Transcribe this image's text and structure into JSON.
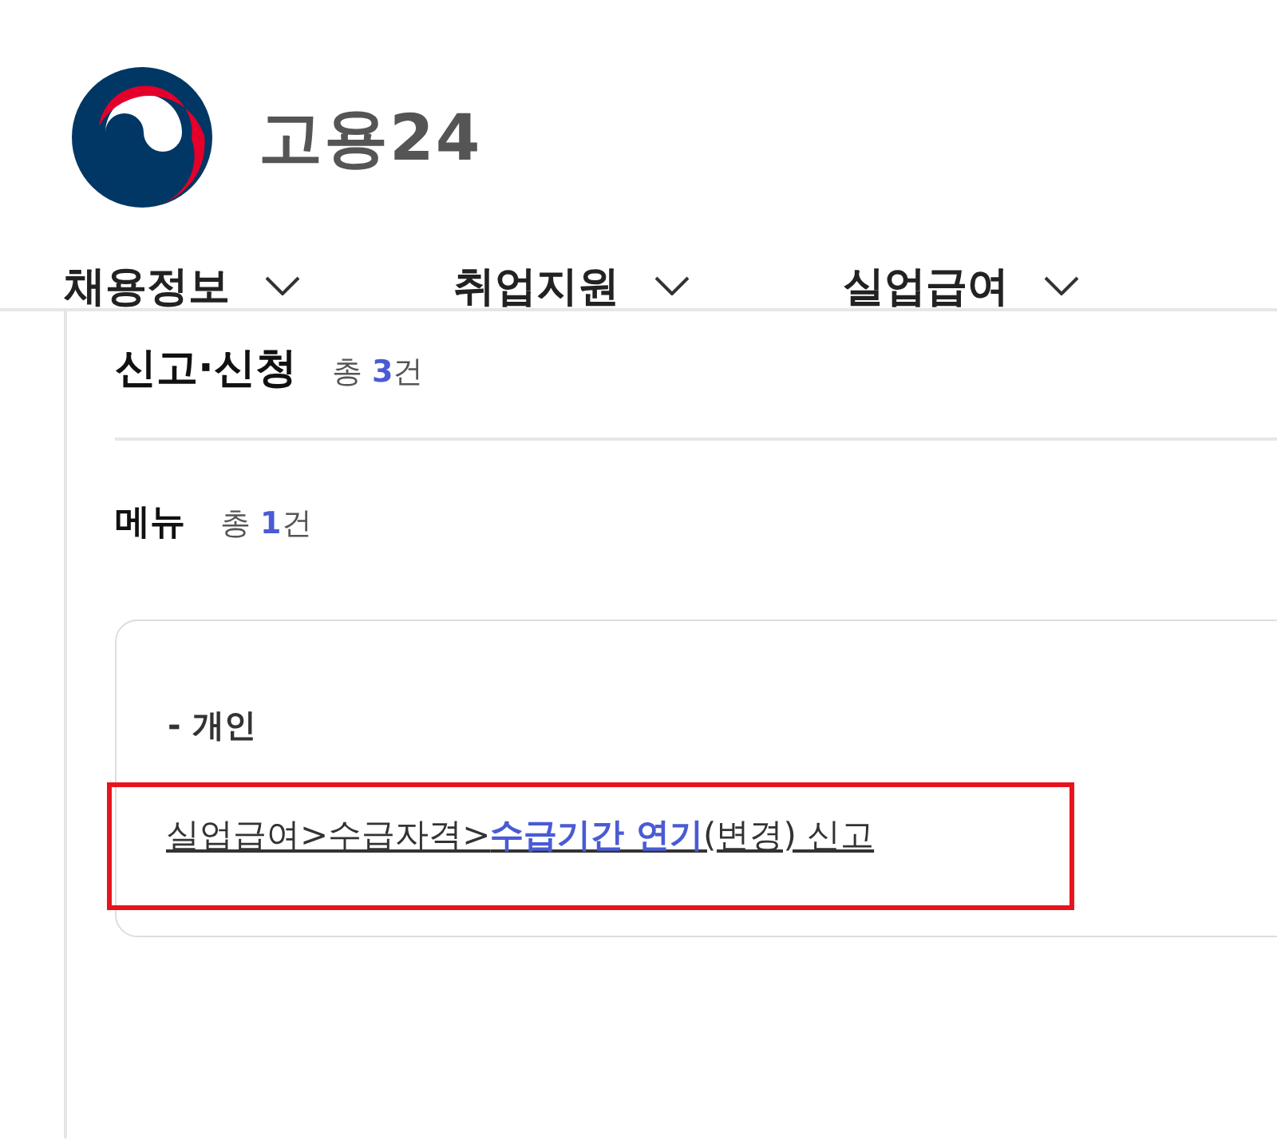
{
  "header": {
    "brand": "고용24"
  },
  "nav": [
    {
      "label": "채용정보",
      "has_menu": true
    },
    {
      "label": "취업지원",
      "has_menu": true
    },
    {
      "label": "실업급여",
      "has_menu": true
    }
  ],
  "section": {
    "title": "신고·신청",
    "count": "총 **3**건"
  },
  "menu": {
    "title": "메뉴",
    "count": "총 **1**건",
    "groups": [
      {
        "label": "- 개인",
        "links": [
          {
            "text": "실업급여>수급자격>**수급기간 연기**(변경) 신고",
            "highlighted": true
          }
        ]
      }
    ]
  }
}
